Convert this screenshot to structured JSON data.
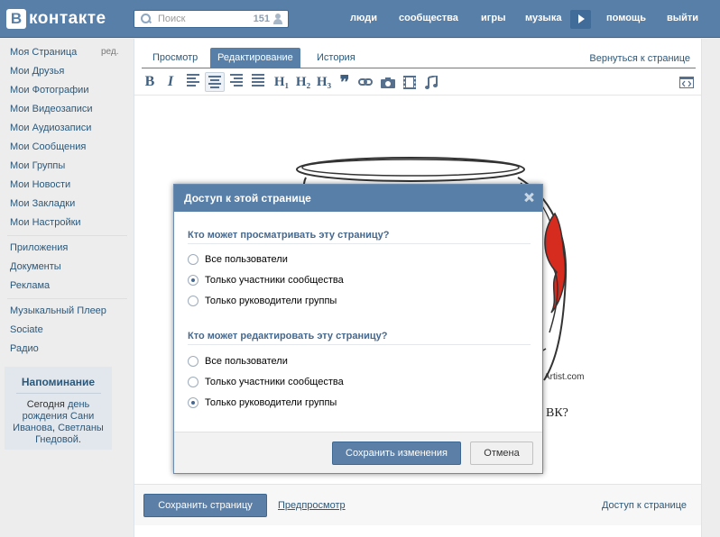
{
  "header": {
    "logo_letter": "В",
    "logo_text": "контакте",
    "search_placeholder": "Поиск",
    "search_count": "151",
    "nav": [
      "люди",
      "сообщества",
      "игры",
      "музыка",
      "помощь",
      "выйти"
    ]
  },
  "sidebar": {
    "edit_label": "ред.",
    "group1": [
      "Моя Страница",
      "Мои Друзья",
      "Мои Фотографии",
      "Мои Видеозаписи",
      "Мои Аудиозаписи",
      "Мои Сообщения",
      "Мои Группы",
      "Мои Новости",
      "Мои Закладки",
      "Мои Настройки"
    ],
    "group2": [
      "Приложения",
      "Документы",
      "Реклама"
    ],
    "group3": [
      "Музыкальный Плеер",
      "Sociate",
      "Радио"
    ],
    "reminder": {
      "title": "Напоминание",
      "text_1": "Сегодня",
      "link_1": "день рождения",
      "link_2": "Сани Иванова",
      "text_2": ",",
      "link_3": "Светланы Гнедовой",
      "text_3": "."
    }
  },
  "tabs": [
    {
      "label": "Просмотр",
      "active": false
    },
    {
      "label": "Редактирование",
      "active": true
    },
    {
      "label": "История",
      "active": false
    }
  ],
  "back_link": "Вернуться к странице",
  "toolbar": {
    "bold": "B",
    "italic": "I",
    "h1": "H₁",
    "h2": "H₂",
    "h3": "H₃",
    "quote": "❞"
  },
  "editor": {
    "image_caption": "Artist.com",
    "question_fragment": "ВК?"
  },
  "footer": {
    "save_page": "Сохранить страницу",
    "preview": "Предпросмотр",
    "access": "Доступ к странице"
  },
  "modal": {
    "title": "Доступ к этой странице",
    "view_title": "Кто может просматривать эту страницу?",
    "view_options": [
      "Все пользователи",
      "Только участники сообщества",
      "Только руководители группы"
    ],
    "view_selected": 1,
    "edit_title": "Кто может редактировать эту страницу?",
    "edit_options": [
      "Все пользователи",
      "Только участники сообщества",
      "Только руководители группы"
    ],
    "edit_selected": 2,
    "save_button": "Сохранить изменения",
    "cancel_button": "Отмена"
  },
  "colors": {
    "header_blue": "#587fa8",
    "link_blue": "#2b587a",
    "section_title": "#45688e"
  }
}
